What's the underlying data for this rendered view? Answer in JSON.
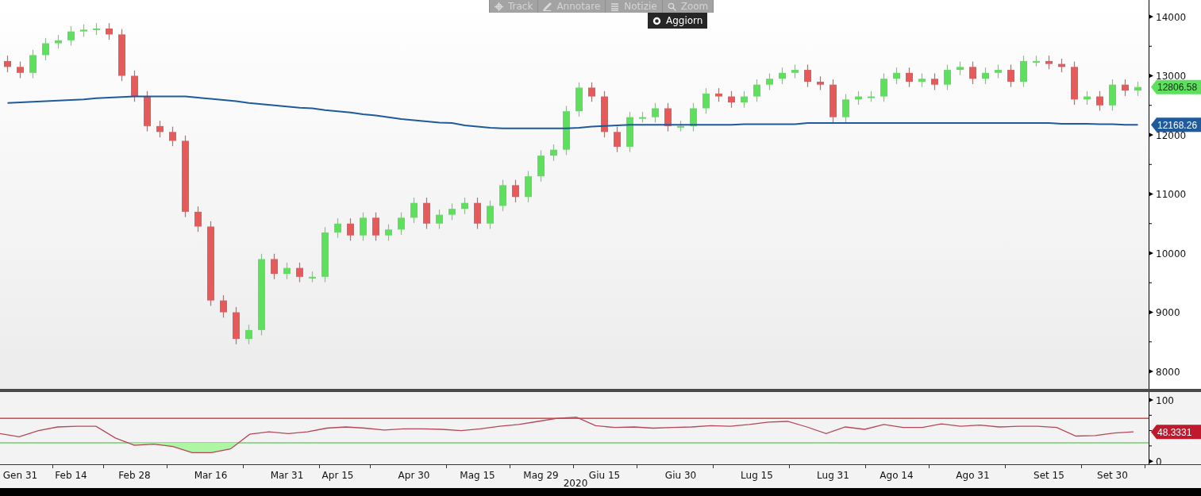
{
  "toolbar": {
    "buttons": [
      {
        "label": "Track",
        "kind": "crosshair"
      },
      {
        "label": "Annotare",
        "kind": "pencil"
      },
      {
        "label": "Notizie",
        "kind": "list"
      },
      {
        "label": "Zoom",
        "kind": "magnifier"
      }
    ],
    "refresh_button": {
      "label": "Aggiorn"
    }
  },
  "price_chart": {
    "last_price_tag": "12806.58",
    "average_tag": "12168.26",
    "chart_data": {
      "type": "candlestick",
      "ylim": [
        7705,
        14282
      ],
      "yticks": [
        8000,
        9000,
        10000,
        11000,
        12000,
        13000,
        14000
      ],
      "categories": [
        null,
        "Gen 31",
        null,
        null,
        null,
        "Feb 14",
        null,
        null,
        null,
        null,
        "Feb 28",
        null,
        null,
        null,
        null,
        null,
        "Mar 16",
        null,
        null,
        null,
        null,
        null,
        "Mar 31",
        null,
        null,
        null,
        "Apr 15",
        null,
        null,
        null,
        null,
        null,
        "Apr 30",
        null,
        null,
        null,
        null,
        "Mag 15",
        null,
        null,
        null,
        null,
        "Mag 29",
        null,
        null,
        null,
        null,
        "Giu 15",
        null,
        null,
        null,
        null,
        null,
        "Giu 30",
        null,
        null,
        null,
        null,
        null,
        "Lug 15",
        null,
        null,
        null,
        null,
        null,
        "Lug 31",
        null,
        null,
        null,
        null,
        "Ago 14",
        null,
        null,
        null,
        null,
        null,
        "Ago 31",
        null,
        null,
        null,
        null,
        null,
        "Set 15",
        null,
        null,
        null,
        null,
        "Set 30",
        null,
        null
      ],
      "ohlc": [
        [
          13250,
          13340,
          13060,
          13150
        ],
        [
          13150,
          13240,
          12960,
          13050
        ],
        [
          13050,
          13440,
          12960,
          13350
        ],
        [
          13350,
          13640,
          13260,
          13550
        ],
        [
          13550,
          13690,
          13460,
          13600
        ],
        [
          13600,
          13840,
          13510,
          13750
        ],
        [
          13750,
          13870,
          13660,
          13780
        ],
        [
          13780,
          13890,
          13690,
          13800
        ],
        [
          13800,
          13890,
          13610,
          13700
        ],
        [
          13700,
          13790,
          12910,
          13000
        ],
        [
          13000,
          13090,
          12560,
          12650
        ],
        [
          12650,
          12740,
          12060,
          12150
        ],
        [
          12150,
          12240,
          11960,
          12050
        ],
        [
          12050,
          12140,
          11810,
          11900
        ],
        [
          11900,
          11990,
          10610,
          10700
        ],
        [
          10700,
          10790,
          10360,
          10450
        ],
        [
          10450,
          10540,
          9110,
          9200
        ],
        [
          9200,
          9290,
          8910,
          9000
        ],
        [
          9000,
          9090,
          8460,
          8550
        ],
        [
          8550,
          8790,
          8460,
          8700
        ],
        [
          8700,
          9990,
          8610,
          9900
        ],
        [
          9900,
          9990,
          9560,
          9650
        ],
        [
          9650,
          9840,
          9560,
          9750
        ],
        [
          9750,
          9840,
          9510,
          9600
        ],
        [
          9600,
          9690,
          9510,
          9600
        ],
        [
          9600,
          10440,
          9510,
          10350
        ],
        [
          10350,
          10590,
          10260,
          10500
        ],
        [
          10500,
          10590,
          10210,
          10300
        ],
        [
          10300,
          10690,
          10210,
          10600
        ],
        [
          10600,
          10690,
          10210,
          10300
        ],
        [
          10300,
          10490,
          10210,
          10400
        ],
        [
          10400,
          10690,
          10310,
          10600
        ],
        [
          10600,
          10940,
          10510,
          10850
        ],
        [
          10850,
          10940,
          10410,
          10500
        ],
        [
          10500,
          10740,
          10410,
          10650
        ],
        [
          10650,
          10840,
          10560,
          10750
        ],
        [
          10750,
          10940,
          10660,
          10850
        ],
        [
          10850,
          10940,
          10410,
          10500
        ],
        [
          10500,
          10890,
          10410,
          10800
        ],
        [
          10800,
          11240,
          10710,
          11150
        ],
        [
          11150,
          11240,
          10860,
          10950
        ],
        [
          10950,
          11390,
          10860,
          11300
        ],
        [
          11300,
          11740,
          11210,
          11650
        ],
        [
          11650,
          11840,
          11560,
          11750
        ],
        [
          11750,
          12490,
          11660,
          12400
        ],
        [
          12400,
          12890,
          12310,
          12800
        ],
        [
          12800,
          12890,
          12560,
          12650
        ],
        [
          12650,
          12740,
          11960,
          12050
        ],
        [
          12050,
          12140,
          11710,
          11800
        ],
        [
          11800,
          12390,
          11710,
          12300
        ],
        [
          12300,
          12390,
          12210,
          12300
        ],
        [
          12300,
          12540,
          12210,
          12450
        ],
        [
          12450,
          12540,
          12060,
          12150
        ],
        [
          12150,
          12240,
          12060,
          12150
        ],
        [
          12150,
          12540,
          12060,
          12450
        ],
        [
          12450,
          12790,
          12360,
          12700
        ],
        [
          12700,
          12790,
          12560,
          12650
        ],
        [
          12650,
          12740,
          12460,
          12550
        ],
        [
          12550,
          12740,
          12460,
          12650
        ],
        [
          12650,
          12940,
          12560,
          12850
        ],
        [
          12850,
          13040,
          12760,
          12950
        ],
        [
          12950,
          13140,
          12860,
          13050
        ],
        [
          13050,
          13190,
          12960,
          13100
        ],
        [
          13100,
          13190,
          12810,
          12900
        ],
        [
          12900,
          12990,
          12760,
          12850
        ],
        [
          12850,
          12940,
          12210,
          12300
        ],
        [
          12300,
          12690,
          12210,
          12600
        ],
        [
          12600,
          12740,
          12510,
          12650
        ],
        [
          12650,
          12740,
          12560,
          12650
        ],
        [
          12650,
          13040,
          12560,
          12950
        ],
        [
          12950,
          13140,
          12860,
          13050
        ],
        [
          13050,
          13140,
          12810,
          12900
        ],
        [
          12900,
          13040,
          12810,
          12950
        ],
        [
          12950,
          13040,
          12760,
          12850
        ],
        [
          12850,
          13190,
          12760,
          13100
        ],
        [
          13100,
          13240,
          13010,
          13150
        ],
        [
          13150,
          13240,
          12860,
          12950
        ],
        [
          12950,
          13140,
          12860,
          13050
        ],
        [
          13050,
          13190,
          12960,
          13100
        ],
        [
          13100,
          13190,
          12810,
          12900
        ],
        [
          12900,
          13340,
          12810,
          13250
        ],
        [
          13250,
          13340,
          13160,
          13250
        ],
        [
          13250,
          13340,
          13110,
          13200
        ],
        [
          13200,
          13290,
          13060,
          13150
        ],
        [
          13150,
          13240,
          12510,
          12600
        ],
        [
          12600,
          12740,
          12510,
          12650
        ],
        [
          12650,
          12740,
          12410,
          12500
        ],
        [
          12500,
          12940,
          12410,
          12850
        ],
        [
          12850,
          12940,
          12660,
          12750
        ],
        [
          12750,
          12900,
          12660,
          12810
        ]
      ],
      "series": [
        {
          "type": "line",
          "color": "#1e5a9c",
          "values": [
            12540,
            12550,
            12560,
            12570,
            12580,
            12590,
            12600,
            12620,
            12630,
            12640,
            12650,
            12650,
            12650,
            12650,
            12650,
            12630,
            12610,
            12590,
            12570,
            12540,
            12520,
            12500,
            12480,
            12460,
            12450,
            12420,
            12400,
            12380,
            12350,
            12330,
            12300,
            12270,
            12250,
            12230,
            12210,
            12200,
            12160,
            12140,
            12120,
            12110,
            12110,
            12110,
            12110,
            12110,
            12110,
            12120,
            12140,
            12150,
            12160,
            12170,
            12170,
            12170,
            12170,
            12170,
            12170,
            12170,
            12170,
            12170,
            12180,
            12180,
            12180,
            12180,
            12180,
            12200,
            12200,
            12200,
            12200,
            12200,
            12200,
            12200,
            12200,
            12200,
            12200,
            12200,
            12200,
            12200,
            12200,
            12200,
            12200,
            12200,
            12200,
            12200,
            12200,
            12190,
            12190,
            12190,
            12180,
            12180,
            12170,
            12170
          ]
        }
      ]
    }
  },
  "rsi_chart": {
    "value_tag": "48.3331",
    "chart_data": {
      "type": "line",
      "ylim": [
        -5,
        113
      ],
      "yticks": [
        0,
        100
      ],
      "series": [
        {
          "color": "#b5475c",
          "values": [
            45,
            40,
            50,
            56,
            57,
            57,
            38,
            26,
            28,
            24,
            14,
            14,
            20,
            44,
            48,
            45,
            48,
            54,
            56,
            54,
            51,
            53,
            53,
            52,
            50,
            53,
            57,
            60,
            65,
            70,
            72,
            58,
            55,
            56,
            54,
            55,
            56,
            58,
            57,
            60,
            64,
            65,
            56,
            45,
            56,
            52,
            60,
            55,
            55,
            61,
            57,
            59,
            56,
            57,
            57,
            55,
            41,
            42,
            46,
            48
          ]
        }
      ],
      "ref_lines": [
        {
          "axis": "y",
          "value": 70,
          "color": "#cc2222"
        },
        {
          "axis": "y",
          "value": 30,
          "color": "#33bb33"
        }
      ]
    }
  },
  "date_axis": {
    "year": "2020"
  }
}
